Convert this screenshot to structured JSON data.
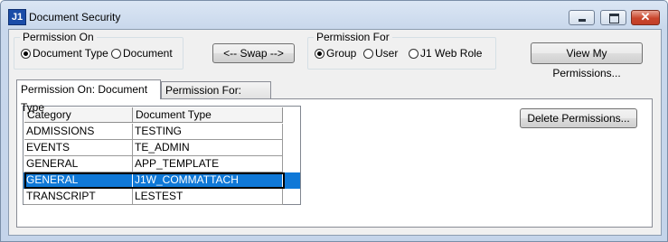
{
  "window": {
    "icon_text": "J1",
    "title": "Document Security",
    "minimize_glyph": "",
    "maximize_glyph": "",
    "close_glyph": "✕"
  },
  "permission_on": {
    "label": "Permission On",
    "options": [
      {
        "label": "Document Type",
        "checked": true
      },
      {
        "label": "Document",
        "checked": false
      }
    ]
  },
  "swap_button": {
    "label": "<-- Swap -->"
  },
  "permission_for": {
    "label": "Permission For",
    "options": [
      {
        "label": "Group",
        "checked": true
      },
      {
        "label": "User",
        "checked": false
      },
      {
        "label": "J1 Web Role",
        "checked": false
      }
    ]
  },
  "view_permissions_button": {
    "label": "View My Permissions..."
  },
  "tabs": [
    {
      "label": "Permission On: Document Type",
      "active": true
    },
    {
      "label": "Permission For: Group",
      "active": false
    }
  ],
  "delete_permissions_button": {
    "label": "Delete Permissions..."
  },
  "grid": {
    "columns": [
      "Category",
      "Document Type"
    ],
    "rows": [
      {
        "category": "ADMISSIONS",
        "document_type": "TESTING",
        "selected": false
      },
      {
        "category": "EVENTS",
        "document_type": "TE_ADMIN",
        "selected": false
      },
      {
        "category": "GENERAL",
        "document_type": "APP_TEMPLATE",
        "selected": false
      },
      {
        "category": "GENERAL",
        "document_type": "J1W_COMMATTACH",
        "selected": true
      },
      {
        "category": "TRANSCRIPT",
        "document_type": "LESTEST",
        "selected": false
      }
    ]
  },
  "colors": {
    "selection": "#0f78d7",
    "title_gradient_top": "#dbe6f4",
    "close_button": "#c9452c"
  }
}
